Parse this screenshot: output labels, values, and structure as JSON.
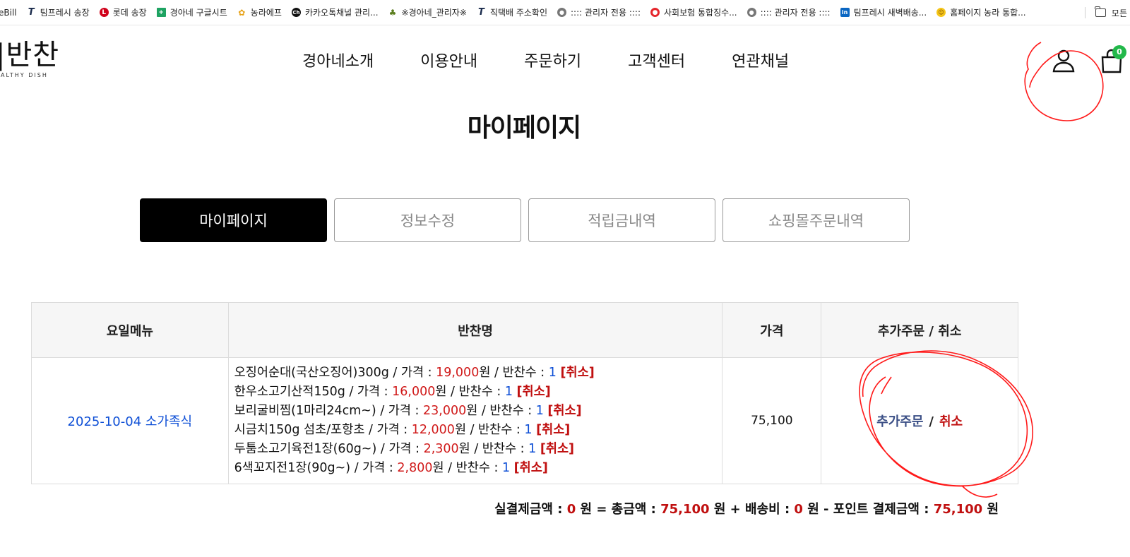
{
  "bookmarks": {
    "items": [
      {
        "label": "eBill",
        "icon": "none-icon"
      },
      {
        "label": "팀프레시 송장",
        "icon": "t-logo-icon"
      },
      {
        "label": "롯데 송장",
        "icon": "lotte-logo-icon"
      },
      {
        "label": "경아네 구글시트",
        "icon": "google-sheets-icon"
      },
      {
        "label": "농라에프",
        "icon": "farm-logo-icon"
      },
      {
        "label": "카카오톡채널 관리...",
        "icon": "kakao-channel-icon"
      },
      {
        "label": "※경아네_관리자※",
        "icon": "admin-logo-icon"
      },
      {
        "label": "직택배 주소확인",
        "icon": "t-logo-icon"
      },
      {
        "label": ":::: 관리자 전용 ::::",
        "icon": "globe-icon"
      },
      {
        "label": "사회보험 통합징수...",
        "icon": "social-insurance-icon"
      },
      {
        "label": ":::: 관리자 전용 ::::",
        "icon": "globe-icon"
      },
      {
        "label": "팀프레시 새벽배송...",
        "icon": "linkedin-icon"
      },
      {
        "label": "홈페이지 농라 통합...",
        "icon": "face-icon"
      }
    ],
    "all_bookmarks_label": "모든"
  },
  "logo": {
    "main": "|반찬",
    "sub": "EALTHY DISH"
  },
  "nav": {
    "items": [
      "경아네소개",
      "이용안내",
      "주문하기",
      "고객센터",
      "연관채널"
    ]
  },
  "header": {
    "cart_count": "0"
  },
  "page": {
    "title": "마이페이지"
  },
  "tabs": [
    {
      "label": "마이페이지",
      "active": true
    },
    {
      "label": "정보수정",
      "active": false
    },
    {
      "label": "적립금내역",
      "active": false
    },
    {
      "label": "쇼핑몰주문내역",
      "active": false
    }
  ],
  "table": {
    "headers": [
      "요일메뉴",
      "반찬명",
      "가격",
      "추가주문 / 취소"
    ],
    "row": {
      "day_menu": "2025-10-04 소가족식",
      "price": "75,100",
      "add_label": "추가주문",
      "slash": "/",
      "cancel_label": "취소",
      "dishes": [
        {
          "name": "오징어순대(국산오징어)300g",
          "price": "19,000",
          "count": "1"
        },
        {
          "name": "한우소고기산적150g",
          "price": "16,000",
          "count": "1"
        },
        {
          "name": "보리굴비찜(1마리24cm~)",
          "price": "23,000",
          "count": "1"
        },
        {
          "name": "시금치150g 섬초/포항초",
          "price": "12,000",
          "count": "1"
        },
        {
          "name": "두툼소고기육전1장(60g~)",
          "price": "2,300",
          "count": "1"
        },
        {
          "name": "6색꼬지전1장(90g~)",
          "price": "2,800",
          "count": "1"
        }
      ]
    },
    "dish_text": {
      "price_prefix": " / 가격 : ",
      "won_suffix": "원 / 반찬수 : ",
      "cancel_tag": "[취소]"
    }
  },
  "summary": {
    "label_actual": "실결제금액 : ",
    "actual": "0",
    "label_total": " 원 = 총금액 : ",
    "total": "75,100",
    "label_shipping": " 원 + 배송비 : ",
    "shipping": "0",
    "label_points": " 원 - 포인트 결제금액 : ",
    "points": "75,100",
    "label_end": " 원"
  },
  "colors": {
    "accent_black": "#000000",
    "price_red": "#d01919",
    "link_blue": "#0e4fd6",
    "cart_badge_green": "#22b84a",
    "annotation_red": "#ff1a1a"
  }
}
